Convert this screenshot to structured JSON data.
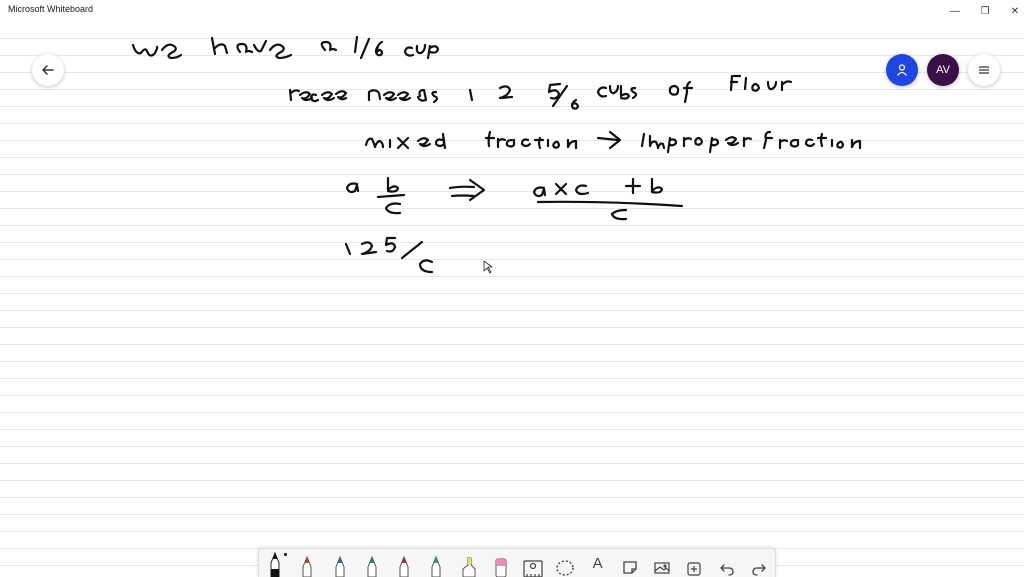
{
  "window": {
    "title": "Microsoft Whiteboard",
    "minimize_glyph": "—",
    "restore_glyph": "❐",
    "close_glyph": "✕"
  },
  "header": {
    "avatar_initials": "AV",
    "invite_color": "#1e46e0",
    "avatar_color": "#3a1048"
  },
  "canvas_ink": {
    "line1": "we have a 1/6 cup",
    "line2": "recipe needs 12 5/6 cups of flour",
    "line3": "mixed fraction -> improper fraction",
    "formula_left": "a b/c",
    "formula_right": "(a x c + b)/c",
    "line5": "12 5/6"
  },
  "toolbar": {
    "tools": [
      {
        "name": "pen-black-icon",
        "color": "#111111"
      },
      {
        "name": "pen-red-icon",
        "color": "#c0392b"
      },
      {
        "name": "pen-blue-icon",
        "color": "#1f6fb2"
      },
      {
        "name": "pen-green-icon",
        "color": "#1e8a5a"
      },
      {
        "name": "pen-magenta-icon",
        "color": "#c2185b"
      },
      {
        "name": "pen-teal-icon",
        "color": "#16a085"
      },
      {
        "name": "highlighter-icon",
        "color": "#e6e64a"
      },
      {
        "name": "eraser-icon",
        "color": "#e88fb5"
      },
      {
        "name": "ruler-icon",
        "color": "#555555"
      },
      {
        "name": "lasso-icon",
        "color": "#555555"
      },
      {
        "name": "text-icon",
        "color": "#555555"
      },
      {
        "name": "note-icon",
        "color": "#555555"
      },
      {
        "name": "image-icon",
        "color": "#555555"
      },
      {
        "name": "insert-icon",
        "color": "#555555"
      },
      {
        "name": "undo-icon",
        "color": "#555555"
      },
      {
        "name": "redo-icon",
        "color": "#555555"
      }
    ],
    "text_tool_glyph": "A"
  }
}
